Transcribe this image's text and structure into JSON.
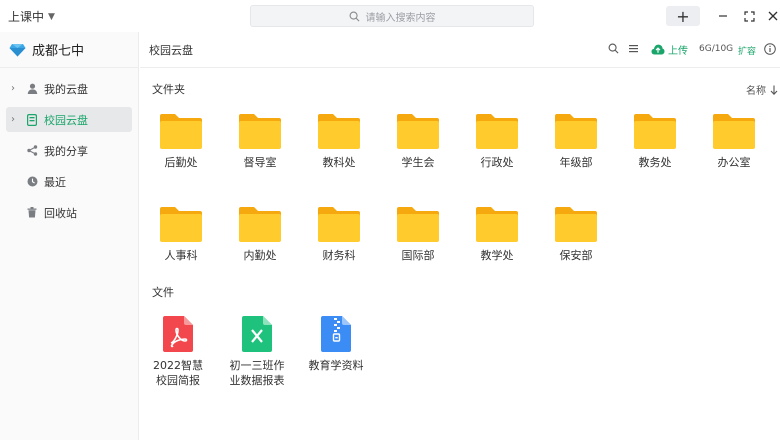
{
  "titlebar": {
    "status_label": "上课中",
    "search_placeholder": "请输入搜索内容"
  },
  "sidebar": {
    "org_name": "成都七中",
    "items": [
      {
        "label": "我的云盘",
        "icon": "user-icon"
      },
      {
        "label": "校园云盘",
        "icon": "school-drive-icon",
        "active": true
      },
      {
        "label": "我的分享",
        "icon": "share-icon"
      },
      {
        "label": "最近",
        "icon": "clock-icon"
      },
      {
        "label": "回收站",
        "icon": "trash-icon"
      }
    ]
  },
  "header": {
    "breadcrumb": "校园云盘",
    "upload_label": "上传",
    "quota": "6G/10G",
    "expand_label": "扩容"
  },
  "folders_section": {
    "title": "文件夹",
    "sort_label": "名称",
    "items": [
      "后勤处",
      "督导室",
      "教科处",
      "学生会",
      "行政处",
      "年级部",
      "教务处",
      "办公室",
      "人事科",
      "内勤处",
      "财务科",
      "国际部",
      "教学处",
      "保安部"
    ]
  },
  "files_section": {
    "title": "文件",
    "items": [
      {
        "name_line1": "2022智慧",
        "name_line2": "校园简报",
        "type": "pdf-icon"
      },
      {
        "name_line1": "初一三班作",
        "name_line2": "业数据报表",
        "type": "excel-icon"
      },
      {
        "name_line1": "教育学资料",
        "name_line2": "",
        "type": "zip-icon"
      }
    ]
  },
  "colors": {
    "accent": "#1aa56a",
    "folder_body": "#ffcb2d",
    "folder_tab": "#f5a90f",
    "pdf": "#f2474c",
    "excel": "#1fc27d",
    "zip": "#3b8df5"
  }
}
